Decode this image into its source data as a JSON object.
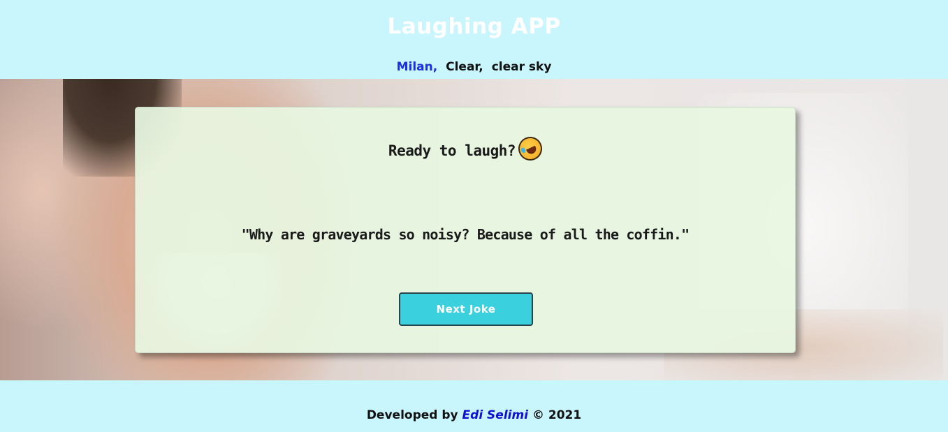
{
  "header": {
    "title": "Laughing APP"
  },
  "weather": {
    "city": "Milan,",
    "condition": "Clear,",
    "description": "clear sky"
  },
  "card": {
    "heading": "Ready to laugh?",
    "heading_icon": "rolling-on-floor-laughing-icon",
    "joke": "\"Why are graveyards so noisy? Because of all the coffin.\"",
    "next_button": "Next Joke"
  },
  "footer": {
    "prefix": "Developed by",
    "author": "Edi Selimi",
    "suffix": "© 2021"
  },
  "colors": {
    "background": "#c9f5fd",
    "button": "#3bd0dd",
    "city": "#1d2de0",
    "author_link": "#1010d0",
    "card": "#e7f6e1"
  }
}
